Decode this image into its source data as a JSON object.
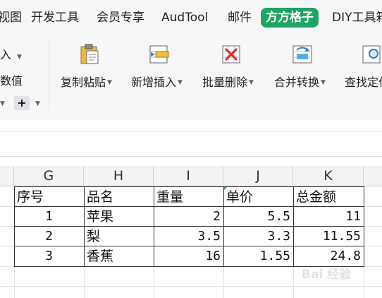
{
  "menu_tabs": [
    {
      "label": "视图",
      "active": false
    },
    {
      "label": "开发工具",
      "active": false
    },
    {
      "label": "会员专享",
      "active": false
    },
    {
      "label": "AudTool",
      "active": false
    },
    {
      "label": "邮件",
      "active": false
    },
    {
      "label": "方方格子",
      "active": true
    },
    {
      "label": "DIY工具箱",
      "active": false
    }
  ],
  "ribbon": {
    "left_top": "入",
    "left_mid": "数值",
    "plus": "+",
    "buttons": [
      {
        "label": "复制粘贴",
        "icon": "clipboard-icon"
      },
      {
        "label": "新增插入",
        "icon": "insert-row-icon"
      },
      {
        "label": "批量删除",
        "icon": "delete-grid-icon"
      },
      {
        "label": "合并转换",
        "icon": "merge-convert-icon"
      },
      {
        "label": "查找定位",
        "icon": "find-locate-icon"
      }
    ]
  },
  "sheet": {
    "columns": [
      "G",
      "H",
      "I",
      "J",
      "K"
    ],
    "header_row": [
      "序号",
      "品名",
      "重量",
      "单价",
      "总金额"
    ],
    "rows": [
      [
        "1",
        "苹果",
        "2",
        "5.5",
        "11"
      ],
      [
        "2",
        "梨",
        "3.5",
        "3.3",
        "11.55"
      ],
      [
        "3",
        "香蕉",
        "16",
        "1.55",
        "24.8"
      ]
    ]
  },
  "watermark": "Bai 经验",
  "colors": {
    "accent": "#1fa463",
    "ribbon_bg": "#f6f7f8"
  }
}
